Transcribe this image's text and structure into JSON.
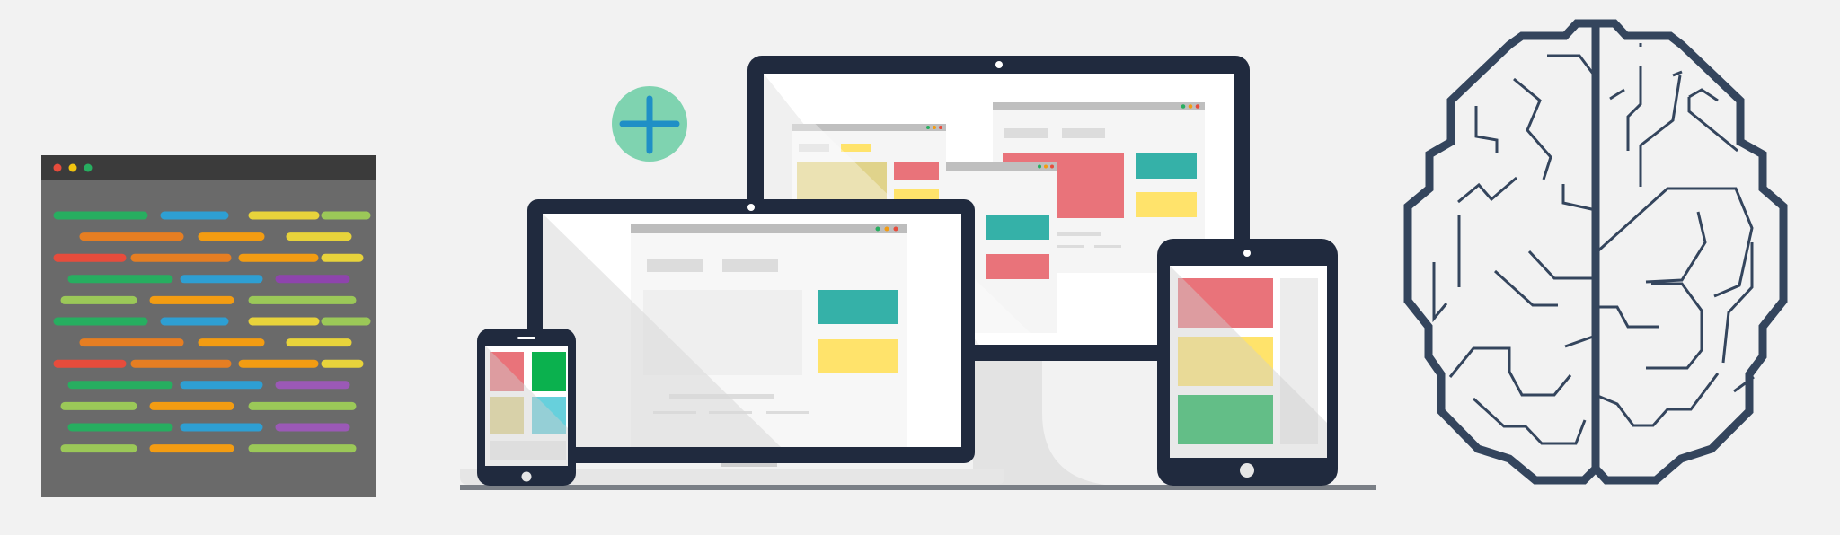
{
  "scene": {
    "background": "#f2f2f2",
    "navy": "#202a3e",
    "brain_stroke": "#34455d"
  },
  "code_window": {
    "icon": "code-editor-window-icon",
    "titlebar_color": "#3b3b3b",
    "body_color": "#6a6a6a",
    "traffic_lights": [
      "#e74c3c",
      "#f1c40f",
      "#27ae60"
    ],
    "line_colors": [
      "#27ae60",
      "#2e9fd3",
      "#e8d33b",
      "#9bc858",
      "#e67e22",
      "#f39c12",
      "#e74c3c",
      "#8e44ad",
      "#9b59b6"
    ]
  },
  "plus_badge": {
    "icon": "plus-icon",
    "fill": "#7fd3b0",
    "cross": "#1f8fc6"
  },
  "devices": {
    "monitor_icon": "desktop-monitor-icon",
    "laptop_icon": "laptop-icon",
    "tablet_icon": "tablet-icon",
    "phone_icon": "smartphone-icon",
    "accent_colors": {
      "red": "#e9737a",
      "teal": "#35b1a8",
      "yellow": "#ffe36b",
      "green": "#0bb14e",
      "light_teal": "#67d0dc",
      "olive": "#e0d38b"
    }
  },
  "brain": {
    "icon": "brain-circuit-icon"
  }
}
